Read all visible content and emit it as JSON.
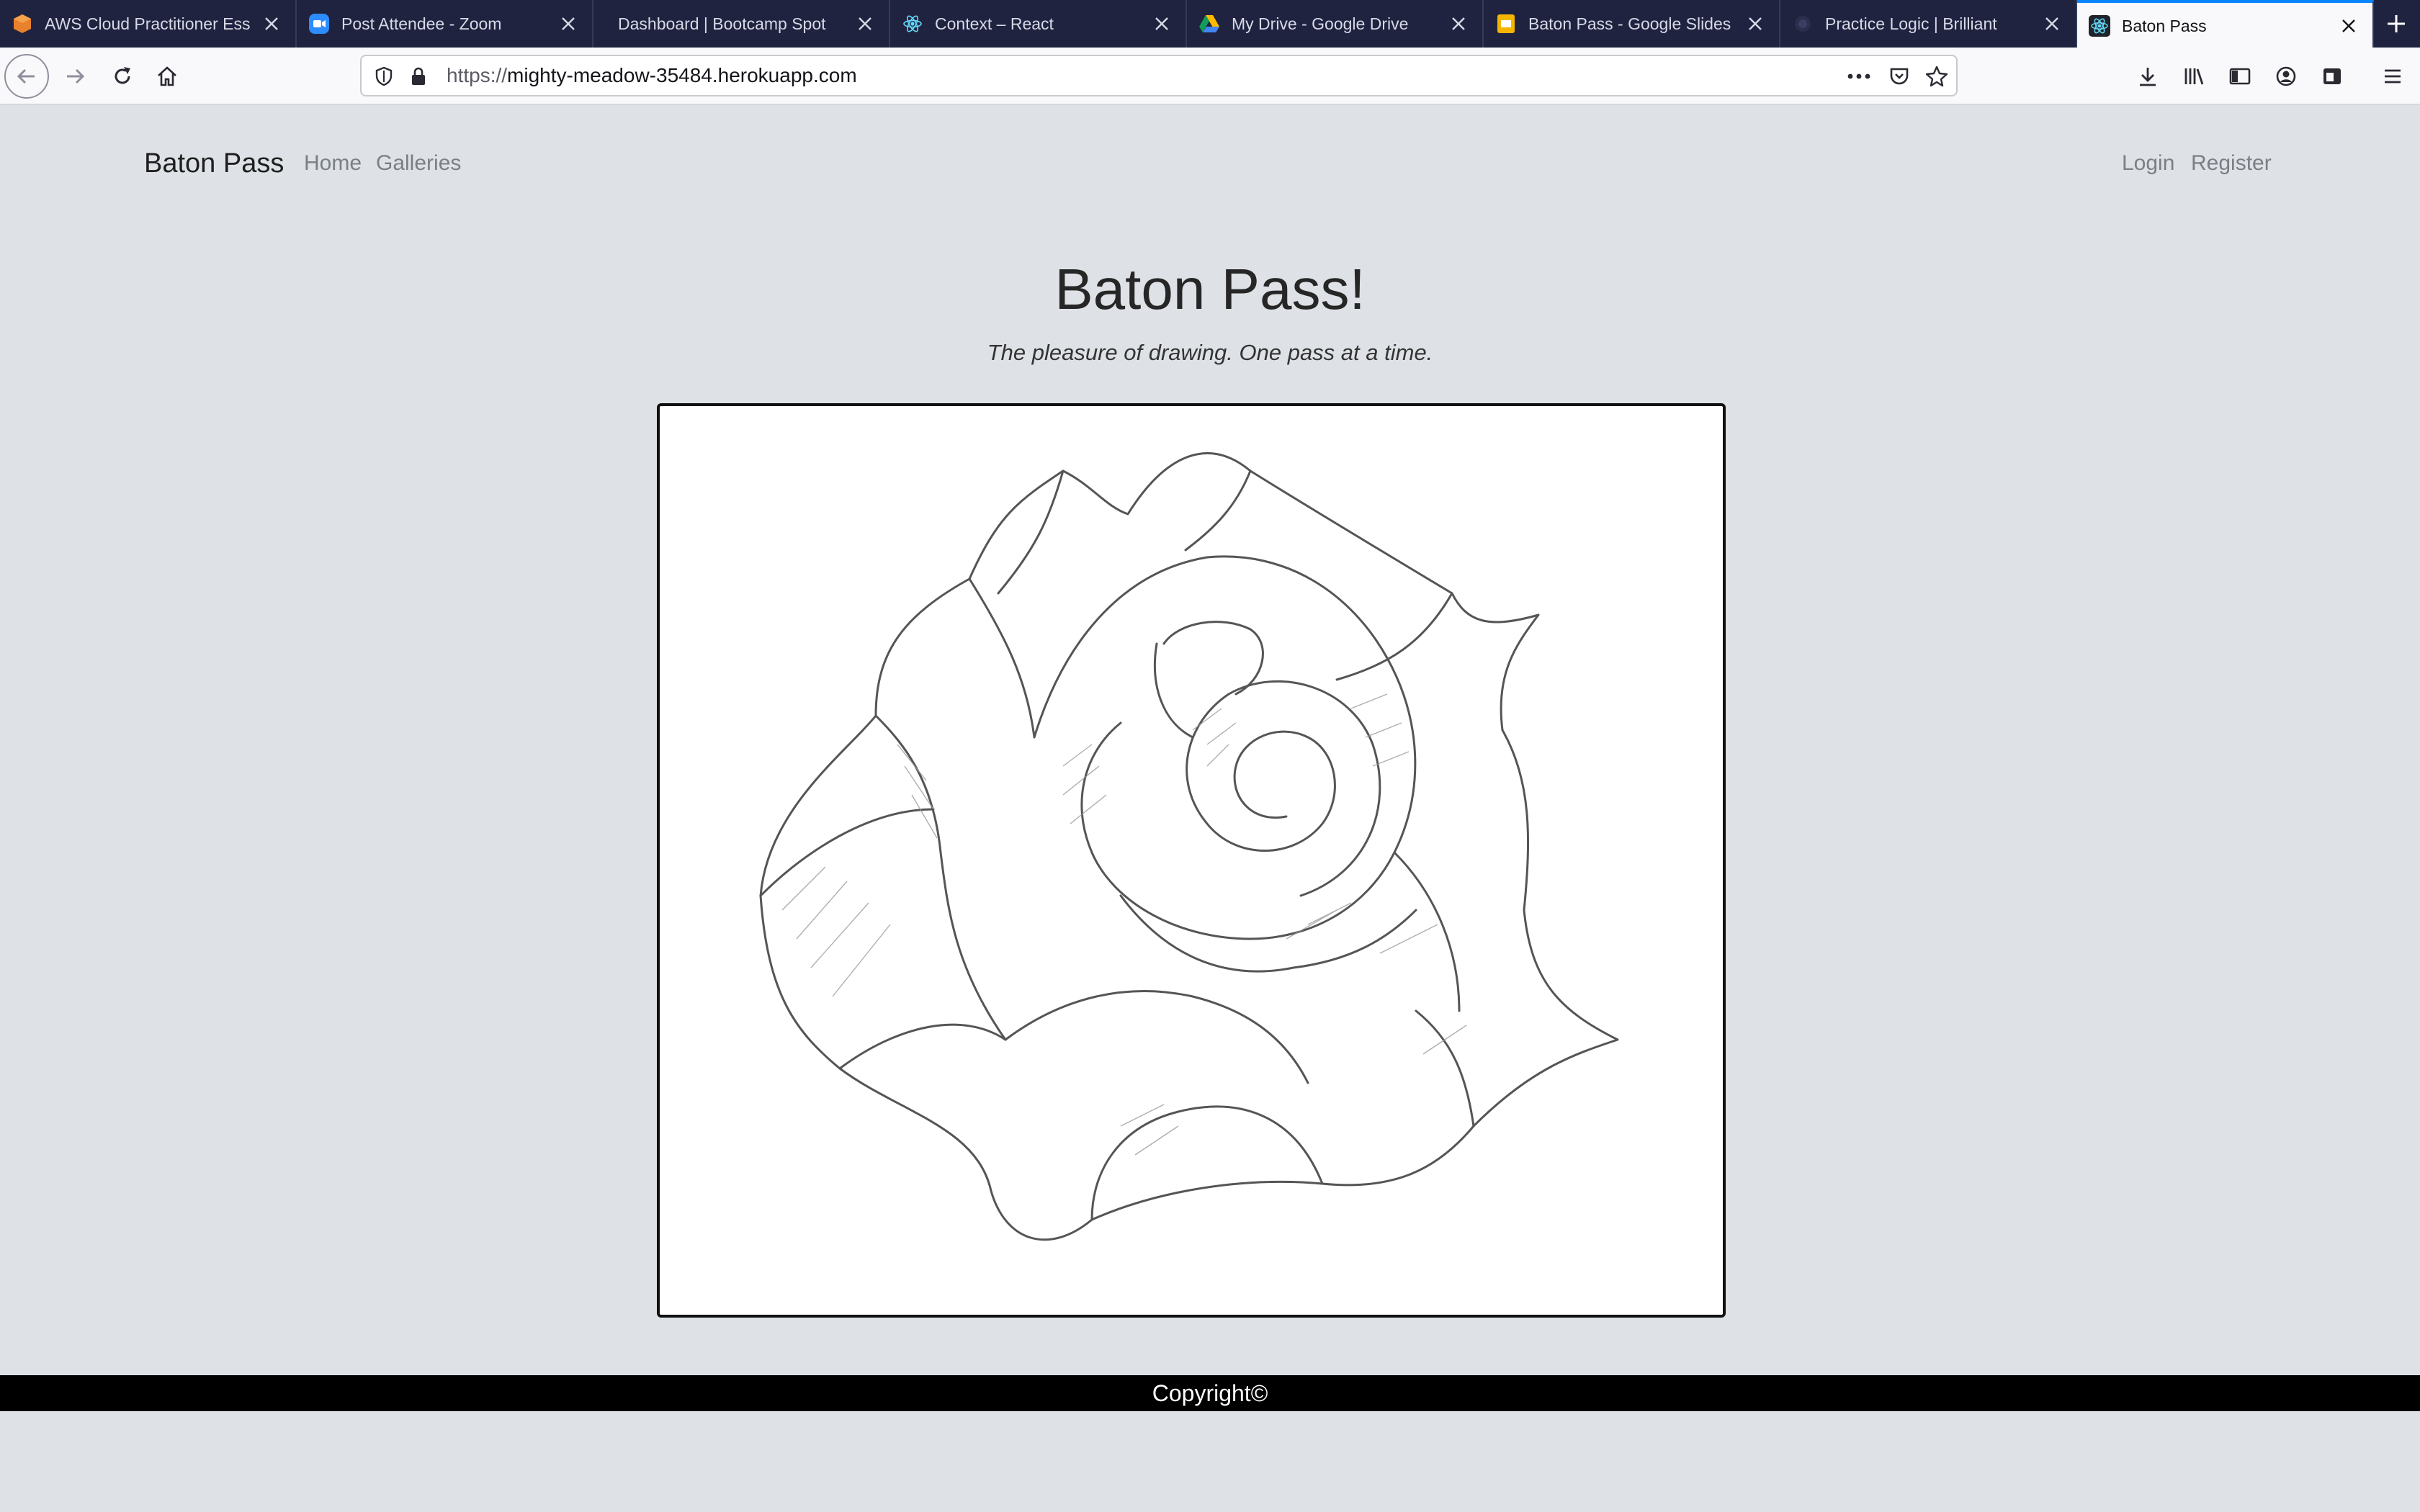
{
  "browser": {
    "tabs": [
      {
        "title": "AWS Cloud Practitioner Ess",
        "icon": "aws-cube-icon",
        "active": false
      },
      {
        "title": "Post Attendee - Zoom",
        "icon": "zoom-icon",
        "active": false
      },
      {
        "title": "Dashboard | Bootcamp Spot",
        "icon": "blank-icon",
        "active": false
      },
      {
        "title": "Context – React",
        "icon": "react-icon",
        "active": false
      },
      {
        "title": "My Drive - Google Drive",
        "icon": "google-drive-icon",
        "active": false
      },
      {
        "title": "Baton Pass - Google Slides",
        "icon": "google-slides-icon",
        "active": false
      },
      {
        "title": "Practice Logic | Brilliant",
        "icon": "brilliant-icon",
        "active": false
      },
      {
        "title": "Baton Pass",
        "icon": "react-icon",
        "active": true
      }
    ],
    "url_scheme": "https://",
    "url_host": "mighty-meadow-35484.herokuapp.com"
  },
  "site": {
    "brand": "Baton Pass",
    "nav_left": [
      "Home",
      "Galleries"
    ],
    "nav_right": [
      "Login",
      "Register"
    ],
    "title": "Baton Pass!",
    "tagline": "The pleasure of drawing. One pass at a time.",
    "footer": "Copyright©"
  },
  "colors": {
    "page_bg": "#dee2e6",
    "tabstrip_bg": "#202340",
    "footer_bg": "#000000",
    "active_tab_accent": "#0a84ff"
  }
}
